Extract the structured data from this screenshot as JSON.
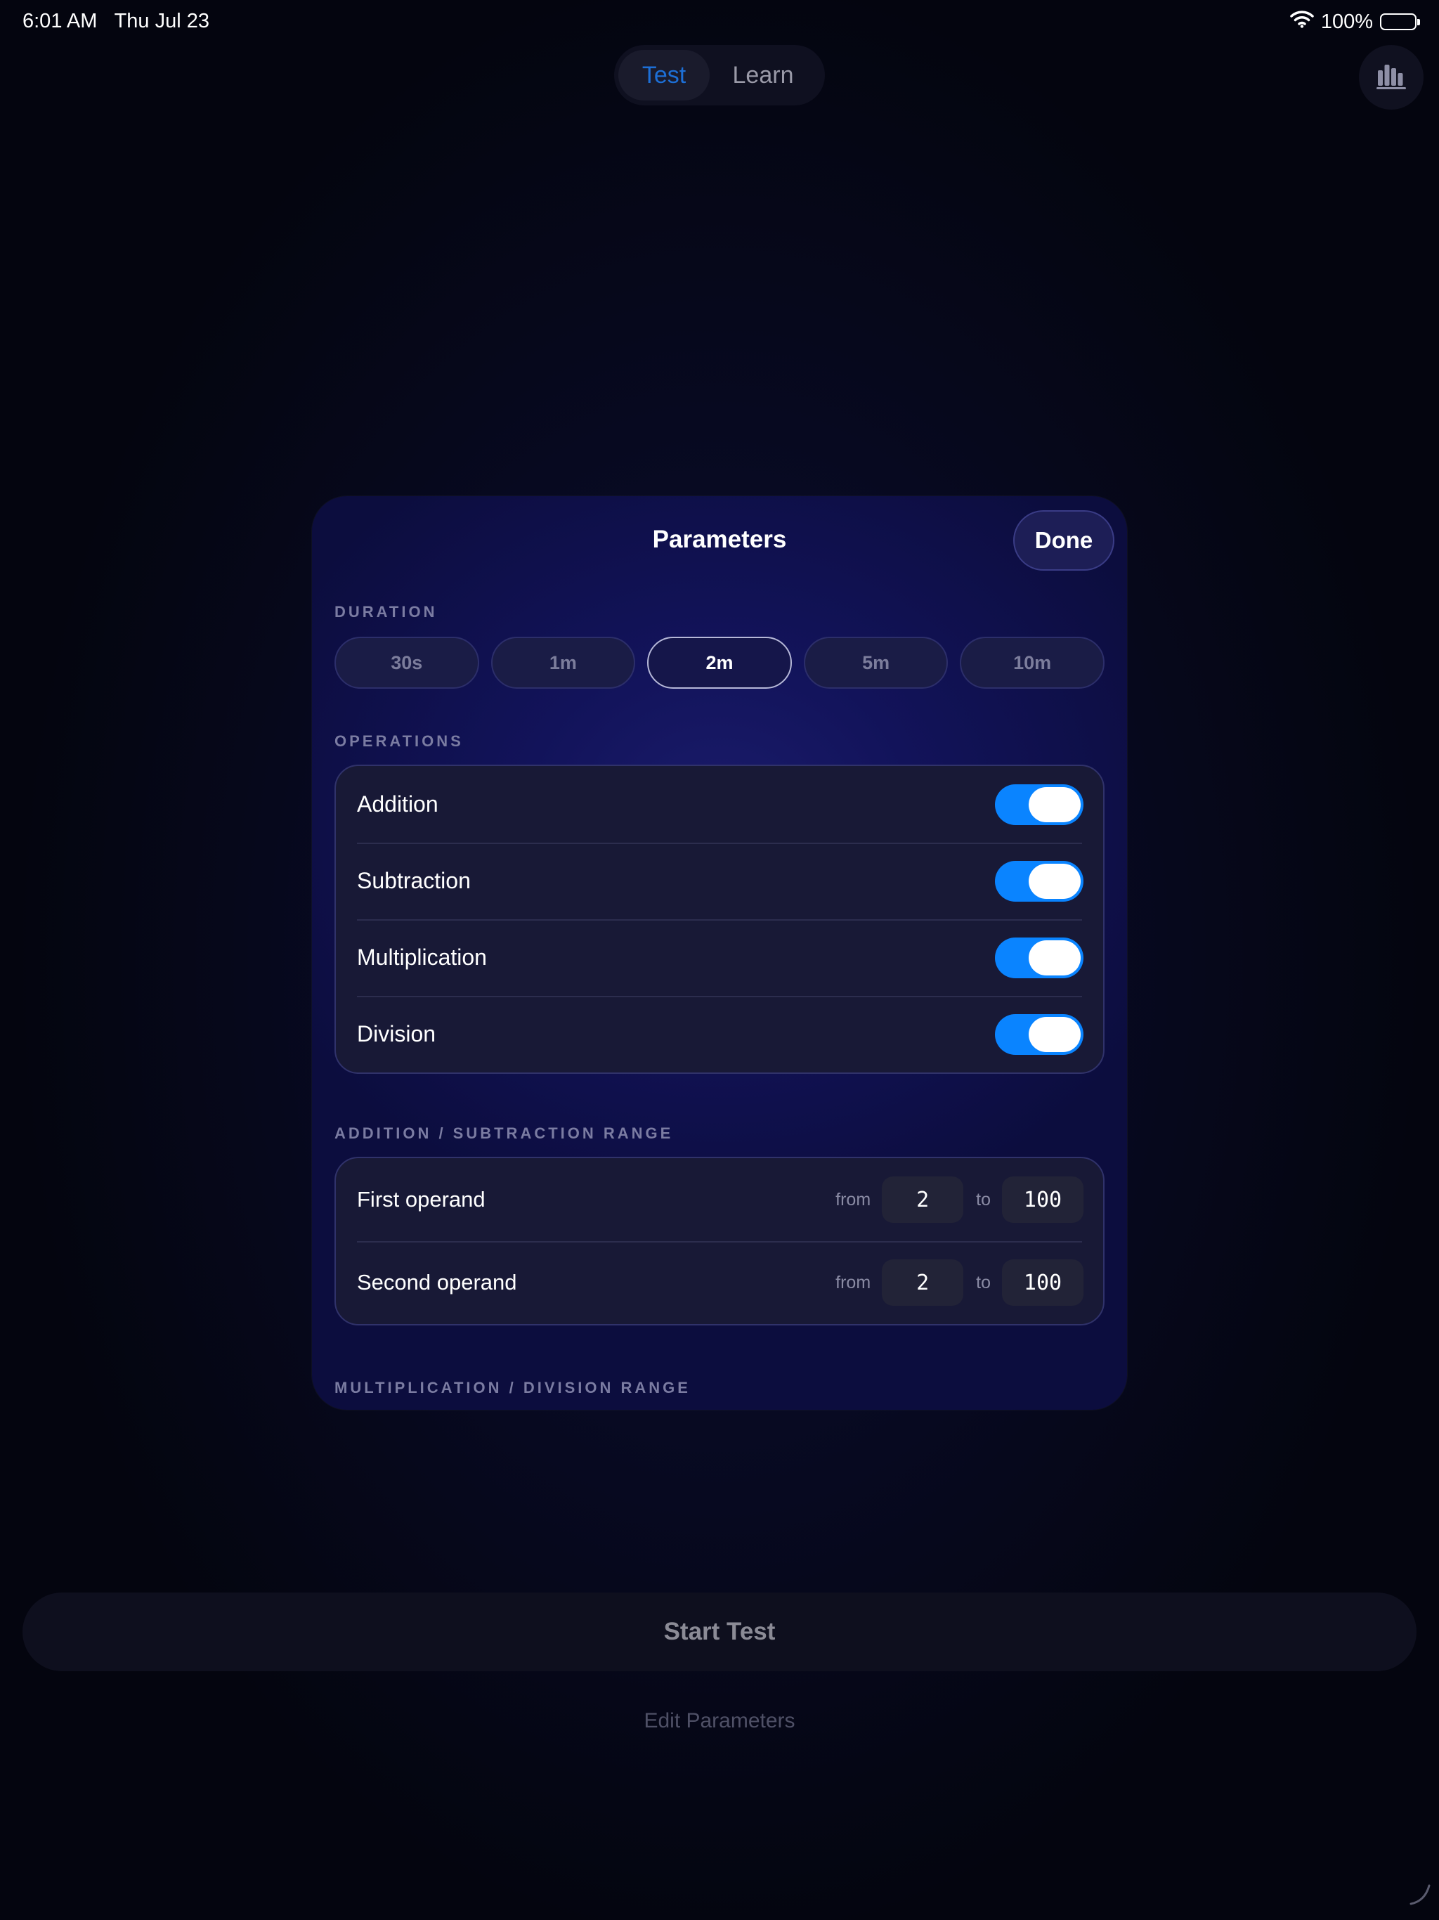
{
  "status_bar": {
    "time": "6:01 AM",
    "date": "Thu Jul 23",
    "battery": "100%",
    "icons": [
      "wifi-icon",
      "battery-icon"
    ]
  },
  "top": {
    "tabs": [
      {
        "label": "Test",
        "active": true
      },
      {
        "label": "Learn",
        "active": false
      }
    ],
    "stats_icon": "bar-chart-icon"
  },
  "modal": {
    "title": "Parameters",
    "done_label": "Done",
    "duration": {
      "label": "DURATION",
      "options": [
        "30s",
        "1m",
        "2m",
        "5m",
        "10m"
      ],
      "selected": "2m"
    },
    "operations": {
      "label": "OPERATIONS",
      "items": [
        {
          "label": "Addition",
          "enabled": true
        },
        {
          "label": "Subtraction",
          "enabled": true
        },
        {
          "label": "Multiplication",
          "enabled": true
        },
        {
          "label": "Division",
          "enabled": true
        }
      ]
    },
    "add_sub_range": {
      "label": "ADDITION / SUBTRACTION RANGE",
      "from_word": "from",
      "to_word": "to",
      "rows": [
        {
          "label": "First operand",
          "from": "2",
          "to": "100"
        },
        {
          "label": "Second operand",
          "from": "2",
          "to": "100"
        }
      ]
    },
    "mul_div_range": {
      "label": "MULTIPLICATION / DIVISION RANGE"
    }
  },
  "bottom": {
    "start_label": "Start Test",
    "edit_label": "Edit Parameters"
  },
  "colors": {
    "accent": "#0a84ff",
    "tab_active_text": "#1d6fd6",
    "modal_bg": "#12135a",
    "background": "#060818"
  }
}
